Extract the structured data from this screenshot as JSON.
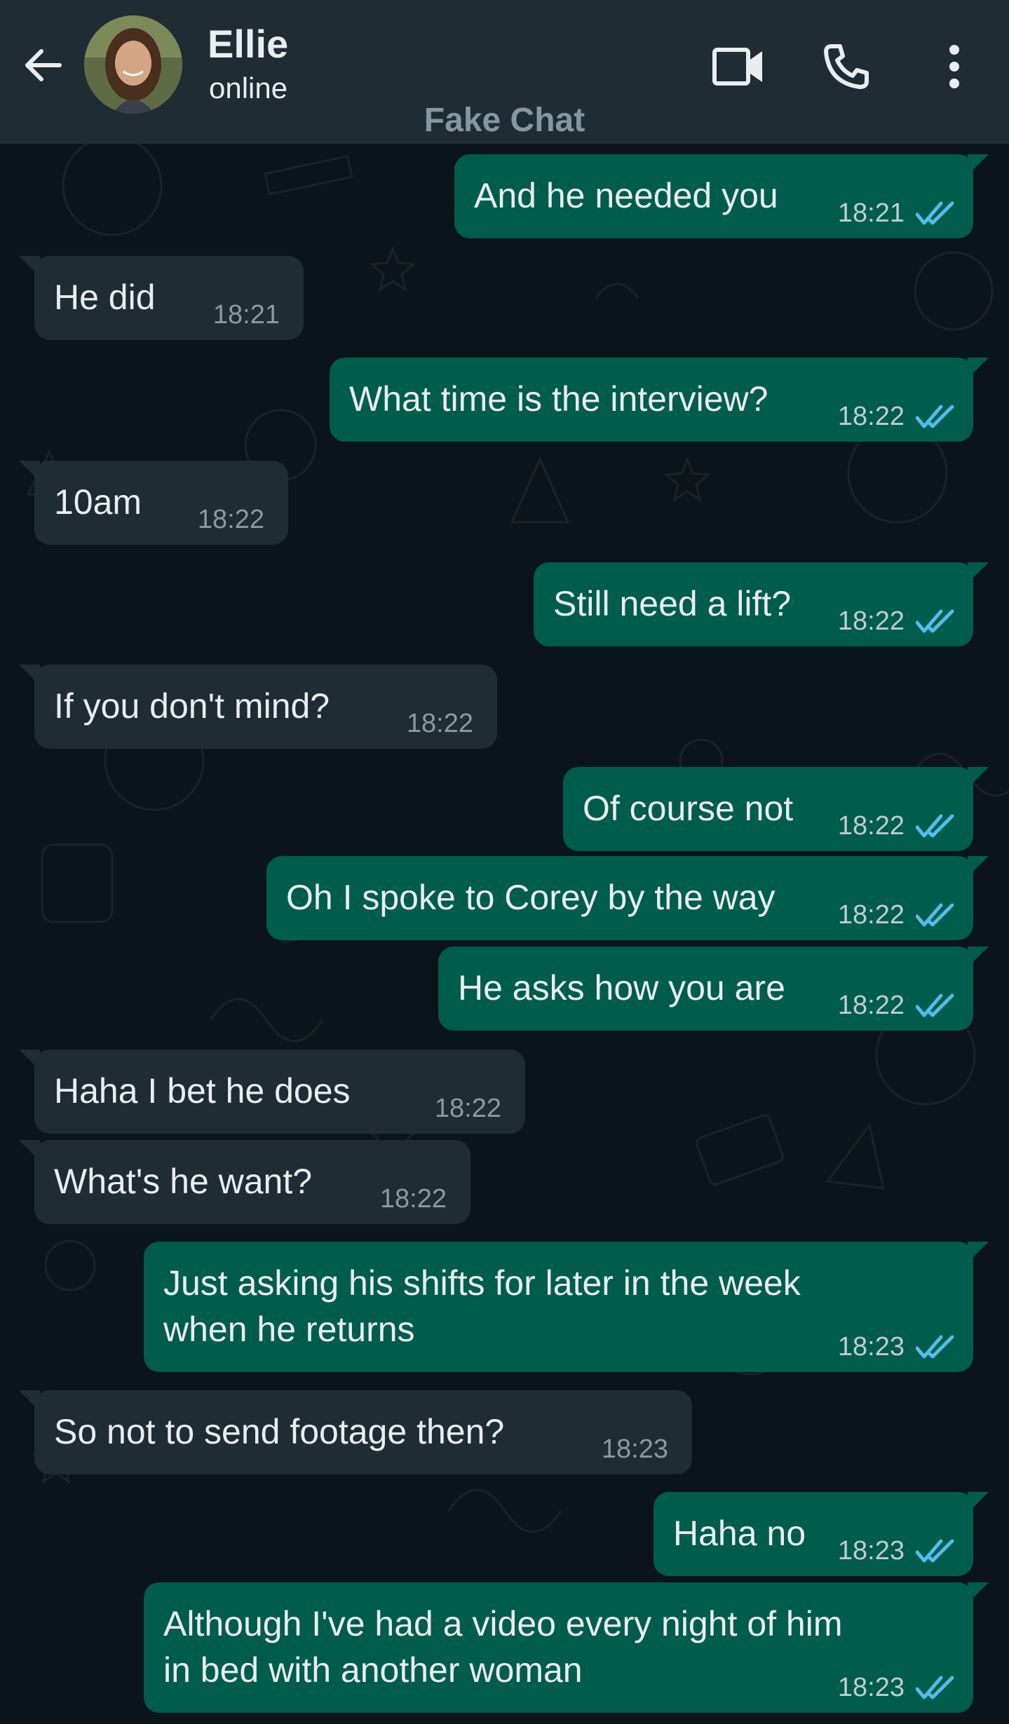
{
  "header": {
    "contact_name": "Ellie",
    "status": "online",
    "watermark": "Fake Chat",
    "icons": [
      "back-arrow-icon",
      "video-call-icon",
      "phone-icon",
      "more-vert-icon"
    ]
  },
  "colors": {
    "header_bg": "#1f2c34",
    "chat_bg": "#0b141a",
    "incoming_bubble": "#1f2c34",
    "outgoing_bubble": "#005c4b",
    "read_ticks": "#53bdeb"
  },
  "messages": [
    {
      "direction": "out",
      "text": "And he needed you",
      "time": "18:21",
      "read": true
    },
    {
      "direction": "in",
      "text": "He did",
      "time": "18:21"
    },
    {
      "direction": "out",
      "text": "What time is the interview?",
      "time": "18:22",
      "read": true
    },
    {
      "direction": "in",
      "text": "10am",
      "time": "18:22"
    },
    {
      "direction": "out",
      "text": "Still need a lift?",
      "time": "18:22",
      "read": true
    },
    {
      "direction": "in",
      "text": "If you don't mind?",
      "time": "18:22"
    },
    {
      "direction": "out",
      "text": "Of course not",
      "time": "18:22",
      "read": true
    },
    {
      "direction": "out",
      "text": "Oh I spoke to Corey by the way",
      "time": "18:22",
      "read": true
    },
    {
      "direction": "out",
      "text": "He asks how you are",
      "time": "18:22",
      "read": true
    },
    {
      "direction": "in",
      "text": "Haha I bet he does",
      "time": "18:22"
    },
    {
      "direction": "in",
      "text": "What's he want?",
      "time": "18:22"
    },
    {
      "direction": "out",
      "text": "Just asking his shifts for later in the week\nwhen he returns",
      "time": "18:23",
      "read": true
    },
    {
      "direction": "in",
      "text": "So not to send footage then?",
      "time": "18:23"
    },
    {
      "direction": "out",
      "text": "Haha no",
      "time": "18:23",
      "read": true
    },
    {
      "direction": "out",
      "text": "Although I've had a video every night of him\nin bed with another woman",
      "time": "18:23",
      "read": true
    }
  ]
}
